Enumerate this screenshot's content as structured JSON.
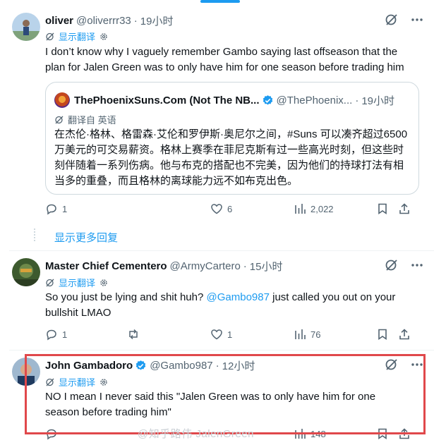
{
  "colors": {
    "accent": "#1d9bf0",
    "secondary_text": "#536471",
    "highlight": "#e0484b"
  },
  "tweet1": {
    "name": "oliver",
    "handle": "@oliverrr33",
    "time": "19小时",
    "translate": "显示翻译",
    "text": "I don’t know why I vaguely remember Gambo saying last offseason that the plan for Jalen Green was to only have him for one season before trading him",
    "quote": {
      "name": "ThePhoenixSuns.Com (Not The NB...",
      "handle": "@ThePhoenix...",
      "time": "19小时",
      "translate_from": "翻译自 英语",
      "text": "在杰伦·格林、格雷森·艾伦和罗伊斯·奥尼尔之间，#Suns 可以凑齐超过6500万美元的可交易薪资。格林上赛季在菲尼克斯有过一些高光时刻，但这些时刻伴随着一系列伤病。他与布克的搭配也不完美，因为他们的持球打法有相当多的重叠，而且格林的离球能力远不如布克出色。"
    },
    "replies": "1",
    "likes": "6",
    "views": "2,022"
  },
  "show_more": "显示更多回复",
  "tweet2": {
    "name": "Master Chief Cementero",
    "handle": "@ArmyCartero",
    "time": "15小时",
    "translate": "显示翻译",
    "text_before": "So you just be lying and shit huh? ",
    "mention": "@Gambo987",
    "text_after": " just called you out on your bullshit LMAO",
    "replies": "1",
    "likes": "1",
    "views": "76"
  },
  "tweet3": {
    "name": "John Gambadoro",
    "handle": "@Gambo987",
    "time": "12小时",
    "translate": "显示翻译",
    "text": "NO I mean I never said this \"Jalen Green was to only have him for one season before trading him\"",
    "views": "148"
  },
  "watermark": "@知乎路伟 JalenGreen",
  "icons": [
    "grok-icon",
    "more-icon",
    "translate-gear-icon",
    "reply-icon",
    "like-icon",
    "views-icon",
    "bookmark-icon",
    "share-icon",
    "retweet-icon",
    "verified-icon"
  ]
}
